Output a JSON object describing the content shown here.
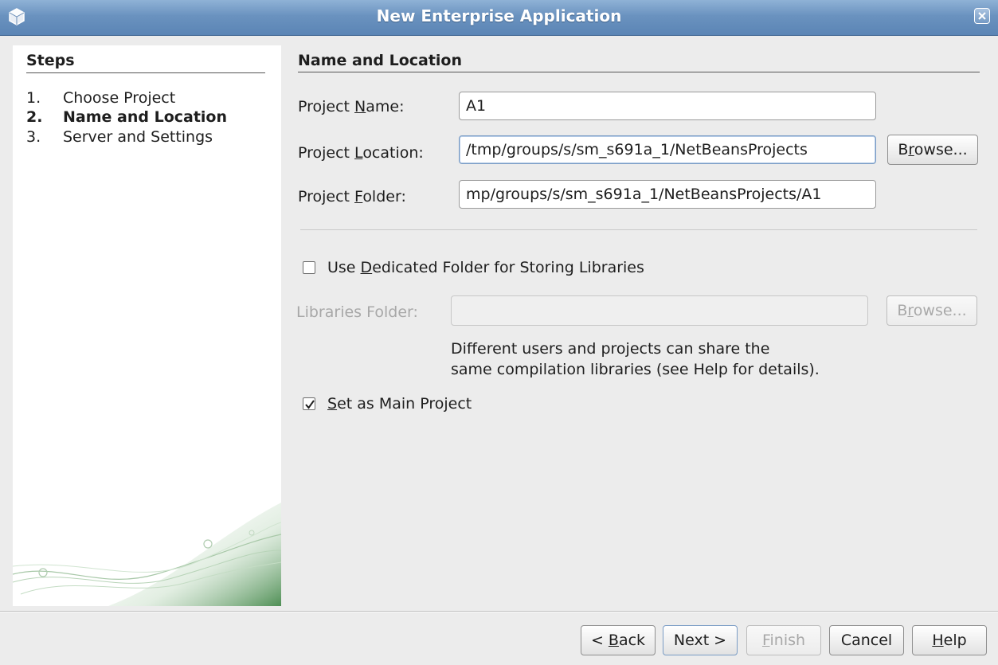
{
  "window": {
    "title": "New Enterprise Application",
    "icon": "netbeans-cube-icon",
    "close_icon": "close-icon"
  },
  "steps": {
    "title": "Steps",
    "items": [
      {
        "num": "1.",
        "label": "Choose Project",
        "current": false
      },
      {
        "num": "2.",
        "label": "Name and Location",
        "current": true
      },
      {
        "num": "3.",
        "label": "Server and Settings",
        "current": false
      }
    ]
  },
  "section": {
    "title": "Name and Location"
  },
  "fields": {
    "project_name": {
      "label_pre": "Project ",
      "label_mnemonic": "N",
      "label_post": "ame:",
      "value": "A1"
    },
    "project_location": {
      "label_pre": "Project ",
      "label_mnemonic": "L",
      "label_post": "ocation:",
      "value": "/tmp/groups/s/sm_s691a_1/NetBeansProjects"
    },
    "project_folder": {
      "label_pre": "Project ",
      "label_mnemonic": "F",
      "label_post": "older:",
      "value": "mp/groups/s/sm_s691a_1/NetBeansProjects/A1"
    }
  },
  "browse_button": {
    "pre": "B",
    "mnemonic": "r",
    "post": "owse..."
  },
  "dedicated_folder": {
    "checked": false,
    "label_pre": "Use ",
    "label_mnemonic": "D",
    "label_post": "edicated Folder for Storing Libraries"
  },
  "libraries": {
    "label": "Libraries Folder:",
    "value": "",
    "browse_pre": "B",
    "browse_mnemonic": "r",
    "browse_post": "owse...",
    "help_line1": "Different users and projects can share the",
    "help_line2": "same compilation libraries (see Help for details)."
  },
  "main_project": {
    "checked": true,
    "label_mnemonic": "S",
    "label_post": "et as Main Project"
  },
  "buttons": {
    "back": {
      "pre": "< ",
      "mnemonic": "B",
      "post": "ack"
    },
    "next": {
      "label": "Next >"
    },
    "finish": {
      "mnemonic": "F",
      "post": "inish"
    },
    "cancel": {
      "label": "Cancel"
    },
    "help": {
      "mnemonic": "H",
      "post": "elp"
    }
  }
}
